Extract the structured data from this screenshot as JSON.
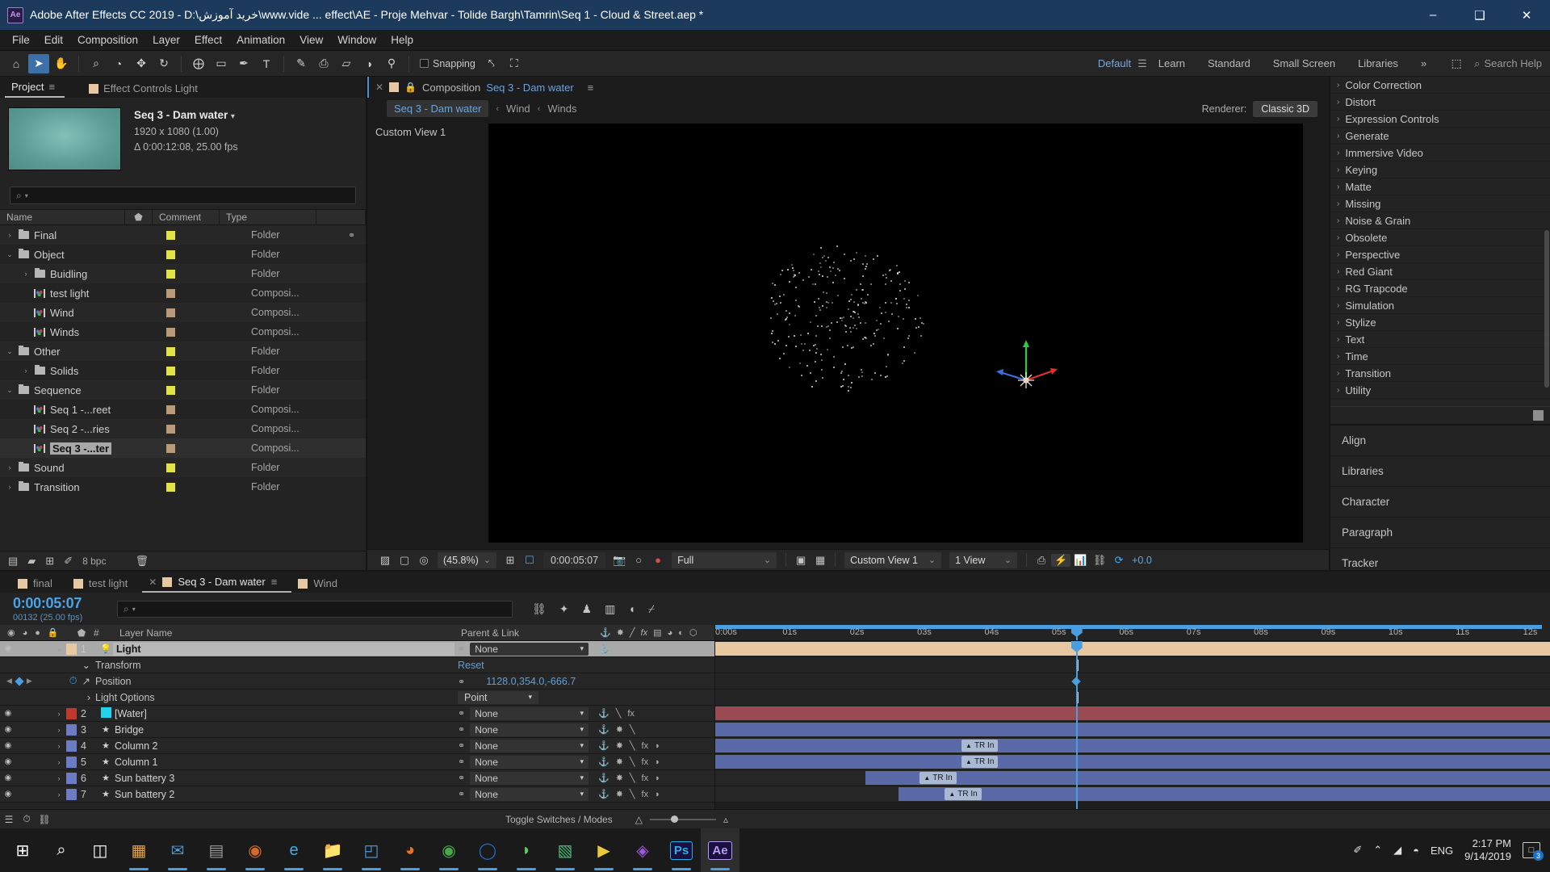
{
  "titlebar": {
    "app_icon": "ae-logo",
    "title": "Adobe After Effects CC 2019 - D:\\خرید آموزش\\www.vide ... effect\\AE - Proje Mehvar - Tolide Bargh\\Tamrin\\Seq 1 - Cloud & Street.aep *",
    "minimize": "–",
    "maximize": "❑",
    "close": "✕"
  },
  "menubar": {
    "items": [
      "File",
      "Edit",
      "Composition",
      "Layer",
      "Effect",
      "Animation",
      "View",
      "Window",
      "Help"
    ]
  },
  "toolbar": {
    "tools": [
      {
        "name": "home-icon",
        "glyph": "⌂"
      },
      {
        "name": "selection-tool",
        "glyph": "➤"
      },
      {
        "name": "hand-tool",
        "glyph": "✋"
      },
      {
        "name": "zoom-tool",
        "glyph": "⌕"
      },
      {
        "name": "orbit-camera-tool",
        "glyph": "◔"
      },
      {
        "name": "pan-camera-tool",
        "glyph": "✥"
      },
      {
        "name": "rotation-tool",
        "glyph": "↻"
      },
      {
        "name": "anchor-point-tool",
        "glyph": "⨁"
      },
      {
        "name": "shape-tool",
        "glyph": "▭"
      },
      {
        "name": "pen-tool",
        "glyph": "✒"
      },
      {
        "name": "type-tool",
        "glyph": "T"
      },
      {
        "name": "brush-tool",
        "glyph": "✎"
      },
      {
        "name": "clone-stamp-tool",
        "glyph": "⎙"
      },
      {
        "name": "eraser-tool",
        "glyph": "▱"
      },
      {
        "name": "roto-brush-tool",
        "glyph": "◑"
      },
      {
        "name": "puppet-pin-tool",
        "glyph": "⚲"
      }
    ],
    "snapping_label": "Snapping",
    "extra_tools": [
      {
        "name": "align-snap-icon",
        "glyph": "⤣"
      },
      {
        "name": "grid-snap-icon",
        "glyph": "⛶"
      }
    ],
    "workspaces": [
      "Default",
      "Learn",
      "Standard",
      "Small Screen",
      "Libraries"
    ],
    "workspace_active": "Default",
    "workspace_overflow": "»",
    "workspace_menu_icon": "☰",
    "sync_icon": "⬚",
    "search_help_placeholder": "Search Help",
    "search_icon": "⌕"
  },
  "project_panel": {
    "tabs": [
      {
        "name": "tab-project",
        "label": "Project",
        "active": true
      },
      {
        "name": "tab-effect-controls",
        "label": "Effect Controls Light",
        "active": false
      }
    ],
    "menu_icon": "≡",
    "selected_item": {
      "name": "Seq 3 - Dam water",
      "dropdown_glyph": "▾",
      "dimensions": "1920 x 1080 (1.00)",
      "duration": "Δ 0:00:12:08, 25.00 fps"
    },
    "search_placeholder": "",
    "search_icon": "⌕",
    "columns": [
      "Name",
      "Comment",
      "Type"
    ],
    "label_col_icon": "⬟",
    "items": [
      {
        "name": "Final",
        "indent": 0,
        "twirl": "›",
        "icon": "folder",
        "label_color": "#e2e24a",
        "type": "Folder",
        "selected": false,
        "has_share": true
      },
      {
        "name": "Object",
        "indent": 0,
        "twirl": "⌄",
        "icon": "folder",
        "label_color": "#e2e24a",
        "type": "Folder",
        "selected": false
      },
      {
        "name": "Buidling",
        "indent": 1,
        "twirl": "›",
        "icon": "folder",
        "label_color": "#e2e24a",
        "type": "Folder",
        "selected": false
      },
      {
        "name": "test light",
        "indent": 1,
        "twirl": "",
        "icon": "comp",
        "label_color": "#b99a78",
        "type": "Composi...",
        "selected": false
      },
      {
        "name": "Wind",
        "indent": 1,
        "twirl": "",
        "icon": "comp",
        "label_color": "#b99a78",
        "type": "Composi...",
        "selected": false
      },
      {
        "name": "Winds",
        "indent": 1,
        "twirl": "",
        "icon": "comp",
        "label_color": "#b99a78",
        "type": "Composi...",
        "selected": false
      },
      {
        "name": "Other",
        "indent": 0,
        "twirl": "⌄",
        "icon": "folder",
        "label_color": "#e2e24a",
        "type": "Folder",
        "selected": false
      },
      {
        "name": "Solids",
        "indent": 1,
        "twirl": "›",
        "icon": "folder",
        "label_color": "#e2e24a",
        "type": "Folder",
        "selected": false
      },
      {
        "name": "Sequence",
        "indent": 0,
        "twirl": "⌄",
        "icon": "folder",
        "label_color": "#e2e24a",
        "type": "Folder",
        "selected": false
      },
      {
        "name": "Seq 1 -...reet",
        "indent": 1,
        "twirl": "",
        "icon": "comp",
        "label_color": "#b99a78",
        "type": "Composi...",
        "selected": false
      },
      {
        "name": "Seq 2 -...ries",
        "indent": 1,
        "twirl": "",
        "icon": "comp",
        "label_color": "#b99a78",
        "type": "Composi...",
        "selected": false
      },
      {
        "name": "Seq 3 -...ter",
        "indent": 1,
        "twirl": "",
        "icon": "comp",
        "label_color": "#b99a78",
        "type": "Composi...",
        "selected": true
      },
      {
        "name": "Sound",
        "indent": 0,
        "twirl": "›",
        "icon": "folder",
        "label_color": "#e2e24a",
        "type": "Folder",
        "selected": false
      },
      {
        "name": "Transition",
        "indent": 0,
        "twirl": "›",
        "icon": "folder",
        "label_color": "#e2e24a",
        "type": "Folder",
        "selected": false
      }
    ],
    "footer": {
      "bit_depth": "8 bpc",
      "icons": [
        {
          "name": "new-comp-icon",
          "glyph": "▤"
        },
        {
          "name": "new-folder-icon",
          "glyph": "▰"
        },
        {
          "name": "project-settings-icon",
          "glyph": "⊞"
        },
        {
          "name": "interpret-footage-icon",
          "glyph": "✐"
        },
        {
          "name": "delete-icon",
          "glyph": "Ὕ1"
        }
      ]
    }
  },
  "composition_panel": {
    "close_icon": "✕",
    "lock_icon": "🔒",
    "tab_prefix": "Composition",
    "tab_name": "Seq 3 - Dam water",
    "menu_icon": "≡",
    "breadcrumb": [
      {
        "label": "Seq 3 - Dam water",
        "current": true
      },
      {
        "label": "Wind",
        "current": false
      },
      {
        "label": "Winds",
        "current": false
      }
    ],
    "breadcrumb_arrow": "‹",
    "renderer_label": "Renderer:",
    "renderer_value": "Classic 3D",
    "view_label": "Custom View 1",
    "toolbar": {
      "icons_left": [
        {
          "name": "toggle-transparency-grid-icon",
          "glyph": "▨"
        },
        {
          "name": "toggle-view-masks-icon",
          "glyph": "▢"
        },
        {
          "name": "toggle-3d-view-icon",
          "glyph": "◎"
        }
      ],
      "magnification": "(45.8%)",
      "chevron": "⌄",
      "choose-grid-icon": "⊞",
      "region-of-interest-icon": "⬚",
      "timecode": "0:00:05:07",
      "snapshot_icon": "📷",
      "show-snapshot-icon": "○",
      "channel_icon": "◕",
      "resolution": "Full",
      "transparency_grid_icon": "▣",
      "alpha_icon": "⬚",
      "view_layout": "Custom View 1",
      "views": "1 View",
      "icons_right": [
        {
          "name": "pixel-aspect-correction-icon",
          "glyph": "⬚"
        },
        {
          "name": "fast-previews-icon",
          "glyph": "⚡"
        },
        {
          "name": "timeline-graph-icon",
          "glyph": "Ὄa"
        },
        {
          "name": "comp-flowchart-icon",
          "glyph": "⛓"
        },
        {
          "name": "reset-exposure-icon",
          "glyph": "⟳"
        }
      ],
      "exposure": "+0.0"
    }
  },
  "effects_panel": {
    "categories": [
      "Color Correction",
      "Distort",
      "Expression Controls",
      "Generate",
      "Immersive Video",
      "Keying",
      "Matte",
      "Missing",
      "Noise & Grain",
      "Obsolete",
      "Perspective",
      "Red Giant",
      "RG Trapcode",
      "Simulation",
      "Stylize",
      "Text",
      "Time",
      "Transition",
      "Utility"
    ],
    "twirl": "›",
    "side_panels": [
      "Align",
      "Libraries",
      "Character",
      "Paragraph",
      "Tracker"
    ]
  },
  "timeline": {
    "tabs": [
      {
        "label": "final",
        "active": false
      },
      {
        "label": "test light",
        "active": false
      },
      {
        "label": "Seq 3 - Dam water",
        "active": true
      },
      {
        "label": "Wind",
        "active": false
      }
    ],
    "close_icon": "✕",
    "menu_icon": "≡",
    "current_time": "0:00:05:07",
    "current_frame": "00132 (25.00 fps)",
    "search_placeholder": "",
    "search_icon": "⌕",
    "head_icons": [
      {
        "name": "comp-mini-flowchart-icon",
        "glyph": "⛓"
      },
      {
        "name": "draft-3d-icon",
        "glyph": "✦"
      },
      {
        "name": "hide-shy-layers-icon",
        "glyph": "♟"
      },
      {
        "name": "frame-blending-icon",
        "glyph": "▥"
      },
      {
        "name": "motion-blur-icon",
        "glyph": "◖"
      },
      {
        "name": "graph-editor-icon",
        "glyph": "⌿"
      }
    ],
    "column_headers": {
      "video_icon": "◉",
      "audio_icon": "◑",
      "solo_icon": "●",
      "lock_icon": "🔒",
      "label_icon": "⬟",
      "number": "#",
      "layer_name": "Layer Name",
      "parent_link": "Parent & Link",
      "switches": [
        "⚓",
        "✸",
        "╲",
        "fx",
        "▤",
        "◑",
        "◐",
        "⬡"
      ]
    },
    "layers": [
      {
        "num": "1",
        "name": "Light",
        "color": "#e8c8a0",
        "type_icon": "💡",
        "parent": "None",
        "selected": true,
        "switches": [
          "⚓"
        ],
        "bar_color": "#e8c8a0",
        "bar_start_pct": 0,
        "bar_end_pct": 100,
        "expanded": true
      },
      {
        "num": "2",
        "name": "[Water]",
        "color": "#c0392b",
        "type_icon": "■",
        "parent": "None",
        "selected": false,
        "switches": [
          "⚓",
          "╲",
          "fx"
        ],
        "bar_color": "#9c4a52",
        "bar_start_pct": 0,
        "bar_end_pct": 100,
        "swatch": "#22d3ee"
      },
      {
        "num": "3",
        "name": "Bridge",
        "color": "#6b7cc4",
        "type_icon": "★",
        "parent": "None",
        "selected": false,
        "switches": [
          "⚓",
          "✸",
          "╲"
        ],
        "bar_color": "#5a6aa8",
        "bar_start_pct": 0,
        "bar_end_pct": 100
      },
      {
        "num": "4",
        "name": "Column 2",
        "color": "#6b7cc4",
        "type_icon": "★",
        "parent": "None",
        "selected": false,
        "switches": [
          "⚓",
          "✸",
          "╲",
          "fx",
          "◗"
        ],
        "bar_color": "#5a6aa8",
        "bar_start_pct": 0,
        "bar_end_pct": 100,
        "tr_label": "TR In",
        "tr_pct": 29.5
      },
      {
        "num": "5",
        "name": "Column 1",
        "color": "#6b7cc4",
        "type_icon": "★",
        "parent": "None",
        "selected": false,
        "switches": [
          "⚓",
          "✸",
          "╲",
          "fx",
          "◗"
        ],
        "bar_color": "#5a6aa8",
        "bar_start_pct": 0,
        "bar_end_pct": 100,
        "tr_label": "TR In",
        "tr_pct": 29.5
      },
      {
        "num": "6",
        "name": "Sun battery 3",
        "color": "#6b7cc4",
        "type_icon": "★",
        "parent": "None",
        "selected": false,
        "switches": [
          "⚓",
          "✸",
          "╲",
          "fx",
          "◗"
        ],
        "bar_color": "#5a6aa8",
        "bar_start_pct": 18,
        "bar_end_pct": 100,
        "tr_label": "TR In",
        "tr_pct": 24.5
      },
      {
        "num": "7",
        "name": "Sun battery 2",
        "color": "#6b7cc4",
        "type_icon": "★",
        "parent": "None",
        "selected": false,
        "switches": [
          "⚓",
          "✸",
          "╲",
          "fx",
          "◗"
        ],
        "bar_color": "#5a6aa8",
        "bar_start_pct": 22,
        "bar_end_pct": 100,
        "tr_label": "TR In",
        "tr_pct": 27.5
      }
    ],
    "light_properties": {
      "transform_label": "Transform",
      "transform_reset": "Reset",
      "position_label": "Position",
      "position_value": "1128.0,354.0,-666.7",
      "light_options_label": "Light Options",
      "light_type": "Point",
      "stopwatch_icon": "⏱",
      "graph_icon": "↗",
      "keyframe_prev": "◀",
      "keyframe_next": "▶",
      "twirl_open": "⌄",
      "twirl_closed": "›"
    },
    "ruler_ticks": [
      "0:00s",
      "01s",
      "02s",
      "03s",
      "04s",
      "05s",
      "06s",
      "07s",
      "08s",
      "09s",
      "10s",
      "11s",
      "12s"
    ],
    "playhead_pct": 43.2,
    "footer": {
      "toggle_switches_label": "Toggle Switches / Modes",
      "icons": [
        {
          "name": "frame-render-time-icon",
          "glyph": "⏱"
        },
        {
          "name": "comp-flowchart-icon",
          "glyph": "⛓"
        },
        {
          "name": "layer-switch-icon",
          "glyph": "▤"
        }
      ],
      "zoom_out_icon": "△",
      "zoom_in_icon": "▵"
    }
  },
  "taskbar": {
    "items": [
      {
        "name": "start-button",
        "glyph": "⊞",
        "color": "#ffffff"
      },
      {
        "name": "search-icon",
        "glyph": "⌕",
        "color": "#ffffff"
      },
      {
        "name": "task-view-icon",
        "glyph": "◫",
        "color": "#ffffff"
      },
      {
        "name": "store-icon",
        "glyph": "▦",
        "color": "#e8a33d"
      },
      {
        "name": "mail-icon",
        "glyph": "✉",
        "color": "#4a9ee0"
      },
      {
        "name": "calculator-icon",
        "glyph": "▤",
        "color": "#9b9b9b"
      },
      {
        "name": "media-player-icon",
        "glyph": "◉",
        "color": "#d06a2a"
      },
      {
        "name": "edge-icon",
        "glyph": "e",
        "color": "#3bb0e8"
      },
      {
        "name": "file-explorer-icon",
        "glyph": "📁",
        "color": "#e8b84a"
      },
      {
        "name": "photos-icon",
        "glyph": "◰",
        "color": "#4a9ee0"
      },
      {
        "name": "firefox-icon",
        "glyph": "◕",
        "color": "#e8732a"
      },
      {
        "name": "chrome-icon",
        "glyph": "◉",
        "color": "#4aa84a"
      },
      {
        "name": "opera-icon",
        "glyph": "◯",
        "color": "#2a6ad0"
      },
      {
        "name": "mediamonkey-icon",
        "glyph": "◗",
        "color": "#5ac85a"
      },
      {
        "name": "notepad-icon",
        "glyph": "▧",
        "color": "#4abf7a"
      },
      {
        "name": "player-icon",
        "glyph": "▶",
        "color": "#e8c83d"
      },
      {
        "name": "premiere-icon",
        "glyph": "◈",
        "color": "#9b5ae0"
      },
      {
        "name": "photoshop-icon",
        "glyph": "Ps",
        "color": "#2ab0e8"
      },
      {
        "name": "aftereffects-icon",
        "glyph": "Ae",
        "color": "#b89cf0"
      }
    ],
    "tray": {
      "pen_icon": "✐",
      "chevron_up": "⌃",
      "network_icon": "◢",
      "volume_icon": "◓",
      "language": "ENG",
      "time": "2:17 PM",
      "date": "9/14/2019",
      "notification_icon": "□",
      "notification_count": "3"
    }
  }
}
